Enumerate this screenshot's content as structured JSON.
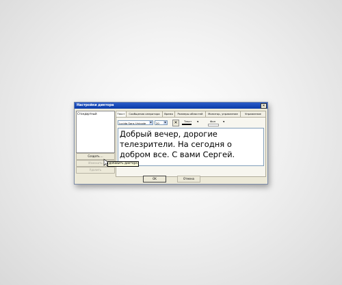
{
  "window": {
    "title": "Настройки диктора",
    "close_glyph": "✕"
  },
  "announcers": {
    "items": [
      "Стандартный"
    ]
  },
  "list_buttons": {
    "create": "Создать ...",
    "edit": "Изменить",
    "delete": "Удалить"
  },
  "tabs": [
    "Текст",
    "Сообщения оператора",
    "Время",
    "Размеры областей",
    "Монитор, управление",
    "Управление"
  ],
  "text_tab": {
    "font_name": "Lucida Sans Unicode",
    "font_size": "20",
    "text_color_label": "Текст",
    "background_label": "Фон",
    "text_color": "#000000",
    "background_color": "#ffffff",
    "sample_text": "Добрый вечер, дорогие телезрители. На сегодня о добром все. С вами Сергей."
  },
  "dialog_buttons": {
    "ok": "OK",
    "cancel": "Отмена"
  },
  "tooltip": {
    "text": "Добавить диктора"
  }
}
